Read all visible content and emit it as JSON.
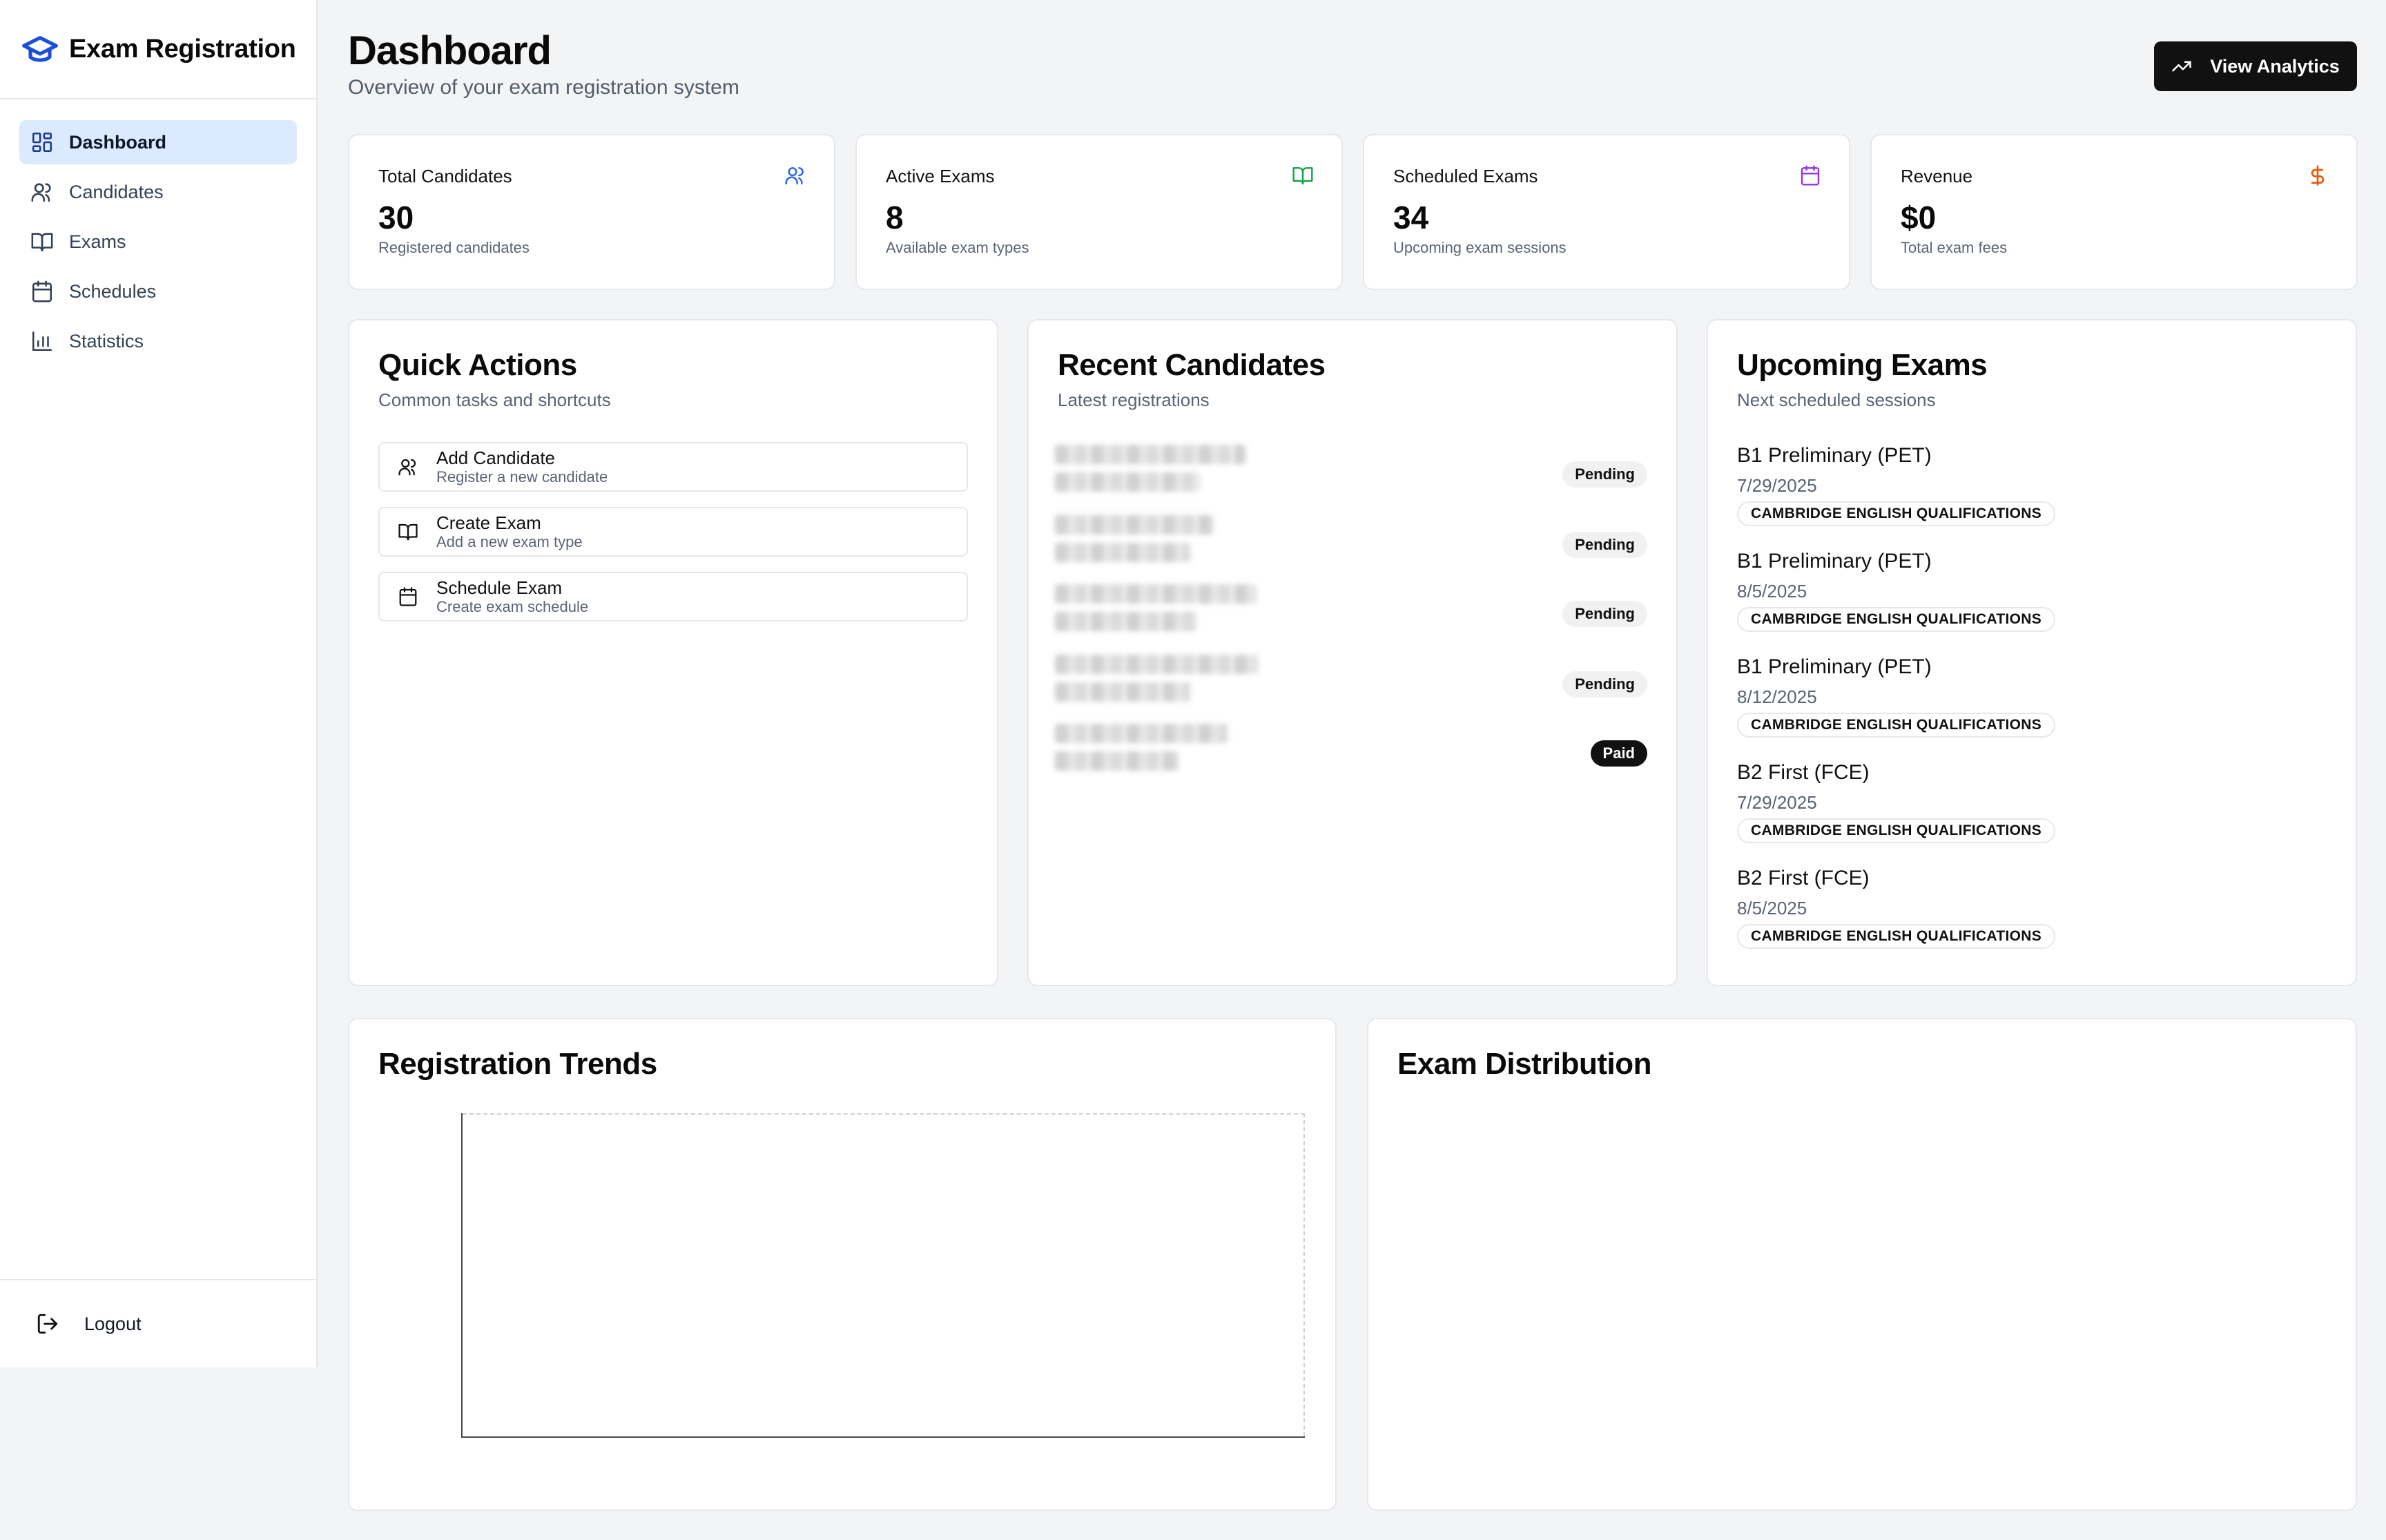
{
  "app": {
    "title": "Exam Registration"
  },
  "sidebar": {
    "items": [
      {
        "label": "Dashboard",
        "icon": "dashboard-icon",
        "active": true
      },
      {
        "label": "Candidates",
        "icon": "users-icon"
      },
      {
        "label": "Exams",
        "icon": "book-icon"
      },
      {
        "label": "Schedules",
        "icon": "calendar-icon"
      },
      {
        "label": "Statistics",
        "icon": "bar-chart-icon"
      }
    ],
    "logout_label": "Logout"
  },
  "header": {
    "title": "Dashboard",
    "subtitle": "Overview of your exam registration system",
    "analytics_button": "View Analytics"
  },
  "stats": [
    {
      "label": "Total Candidates",
      "value": "30",
      "desc": "Registered candidates",
      "icon": "users-icon",
      "color": "#2563eb"
    },
    {
      "label": "Active Exams",
      "value": "8",
      "desc": "Available exam types",
      "icon": "book-icon",
      "color": "#16a34a"
    },
    {
      "label": "Scheduled Exams",
      "value": "34",
      "desc": "Upcoming exam sessions",
      "icon": "calendar-icon",
      "color": "#9333ea"
    },
    {
      "label": "Revenue",
      "value": "$0",
      "desc": "Total exam fees",
      "icon": "dollar-icon",
      "color": "#ea580c"
    }
  ],
  "quick_actions": {
    "title": "Quick Actions",
    "subtitle": "Common tasks and shortcuts",
    "items": [
      {
        "title": "Add Candidate",
        "desc": "Register a new candidate",
        "icon": "users-icon"
      },
      {
        "title": "Create Exam",
        "desc": "Add a new exam type",
        "icon": "book-icon"
      },
      {
        "title": "Schedule Exam",
        "desc": "Create exam schedule",
        "icon": "calendar-icon"
      }
    ]
  },
  "recent_candidates": {
    "title": "Recent Candidates",
    "subtitle": "Latest registrations",
    "items": [
      {
        "status": "Pending"
      },
      {
        "status": "Pending"
      },
      {
        "status": "Pending"
      },
      {
        "status": "Pending"
      },
      {
        "status": "Paid"
      }
    ]
  },
  "upcoming_exams": {
    "title": "Upcoming Exams",
    "subtitle": "Next scheduled sessions",
    "items": [
      {
        "name": "B1 Preliminary (PET)",
        "date": "7/29/2025",
        "tag": "CAMBRIDGE ENGLISH QUALIFICATIONS"
      },
      {
        "name": "B1 Preliminary (PET)",
        "date": "8/5/2025",
        "tag": "CAMBRIDGE ENGLISH QUALIFICATIONS"
      },
      {
        "name": "B1 Preliminary (PET)",
        "date": "8/12/2025",
        "tag": "CAMBRIDGE ENGLISH QUALIFICATIONS"
      },
      {
        "name": "B2 First (FCE)",
        "date": "7/29/2025",
        "tag": "CAMBRIDGE ENGLISH QUALIFICATIONS"
      },
      {
        "name": "B2 First (FCE)",
        "date": "8/5/2025",
        "tag": "CAMBRIDGE ENGLISH QUALIFICATIONS"
      }
    ]
  },
  "registration_trends": {
    "title": "Registration Trends"
  },
  "exam_distribution": {
    "title": "Exam Distribution"
  }
}
